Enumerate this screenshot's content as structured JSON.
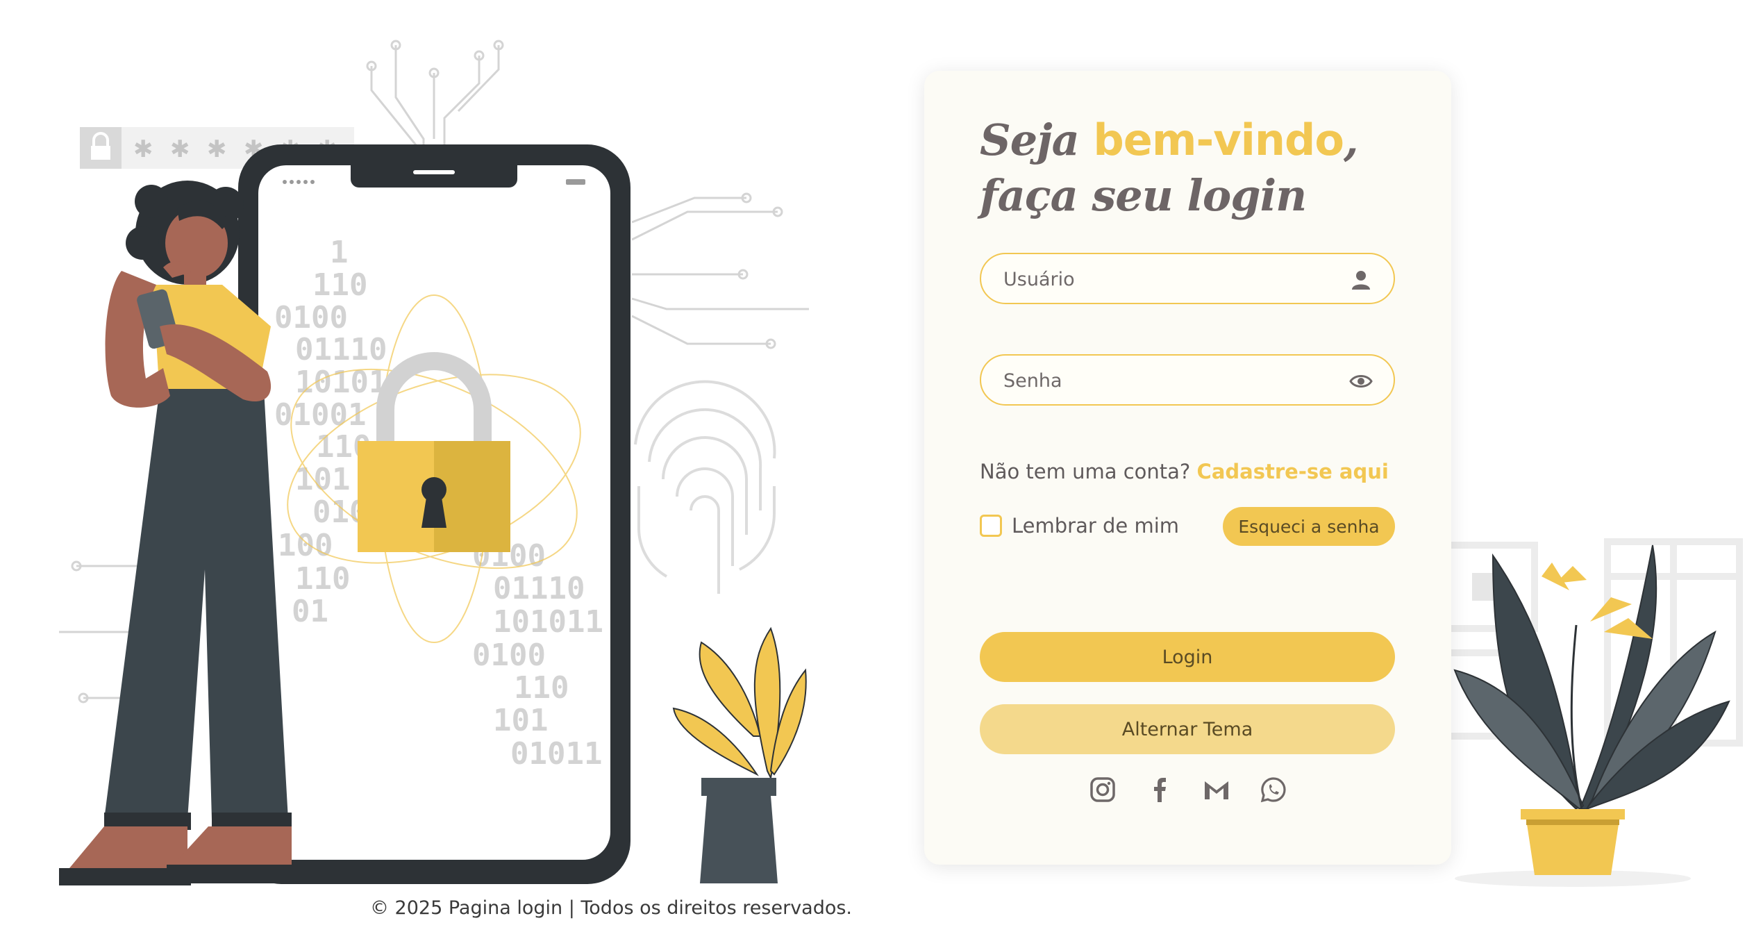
{
  "login": {
    "title_part1": "Seja ",
    "title_highlight": "bem-vindo",
    "title_comma": ",",
    "title_part2": "faça seu login",
    "username_placeholder": "Usuário",
    "password_placeholder": "Senha",
    "signup_prompt": "Não tem uma conta? ",
    "signup_link": "Cadastre-se aqui",
    "remember_label": "Lembrar de mim",
    "forgot_label": "Esqueci a senha",
    "login_label": "Login",
    "theme_label": "Alternar Tema"
  },
  "illustration": {
    "binary_lines": [
      "1",
      "110",
      "0100",
      "01110",
      "10101",
      "01001",
      "110",
      "101",
      "010",
      "100",
      "110",
      "01"
    ],
    "binary_lines_right": [
      "0100",
      "01110",
      "101011",
      "0100",
      "110",
      "101",
      "01011"
    ]
  },
  "social": {
    "icons": [
      "instagram-icon",
      "facebook-icon",
      "gmail-icon",
      "whatsapp-icon"
    ]
  },
  "footer": {
    "text": "© 2025 Pagina login | Todos os direitos reservados."
  },
  "colors": {
    "accent": "#f2c752",
    "accent_light": "#f4d98c",
    "text": "#5f5a5b",
    "dark": "#2d3236",
    "card_bg": "#fcfbf5"
  }
}
